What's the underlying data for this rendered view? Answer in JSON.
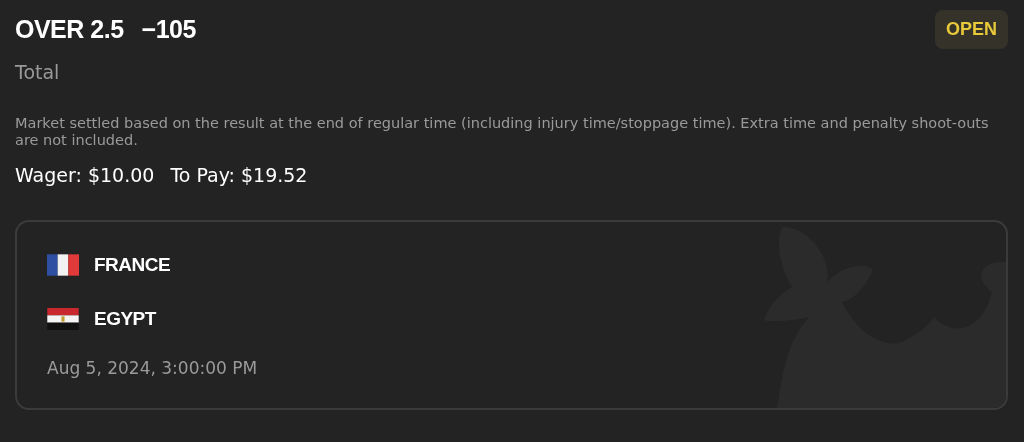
{
  "selection": "OVER 2.5",
  "odds": "−105",
  "status": {
    "label": "OPEN"
  },
  "market": "Total",
  "description": "Market settled based on the result at the end of regular time (including injury time/stoppage time). Extra time and penalty shoot-outs are not included.",
  "wager": {
    "label": "Wager:",
    "value": "$10.00"
  },
  "payout": {
    "label": "To Pay:",
    "value": "$19.52"
  },
  "event": {
    "teams": [
      {
        "name": "FRANCE",
        "kind": "france"
      },
      {
        "name": "EGYPT",
        "kind": "egypt"
      }
    ],
    "date": "Aug 5, 2024, 3:00:00 PM"
  }
}
